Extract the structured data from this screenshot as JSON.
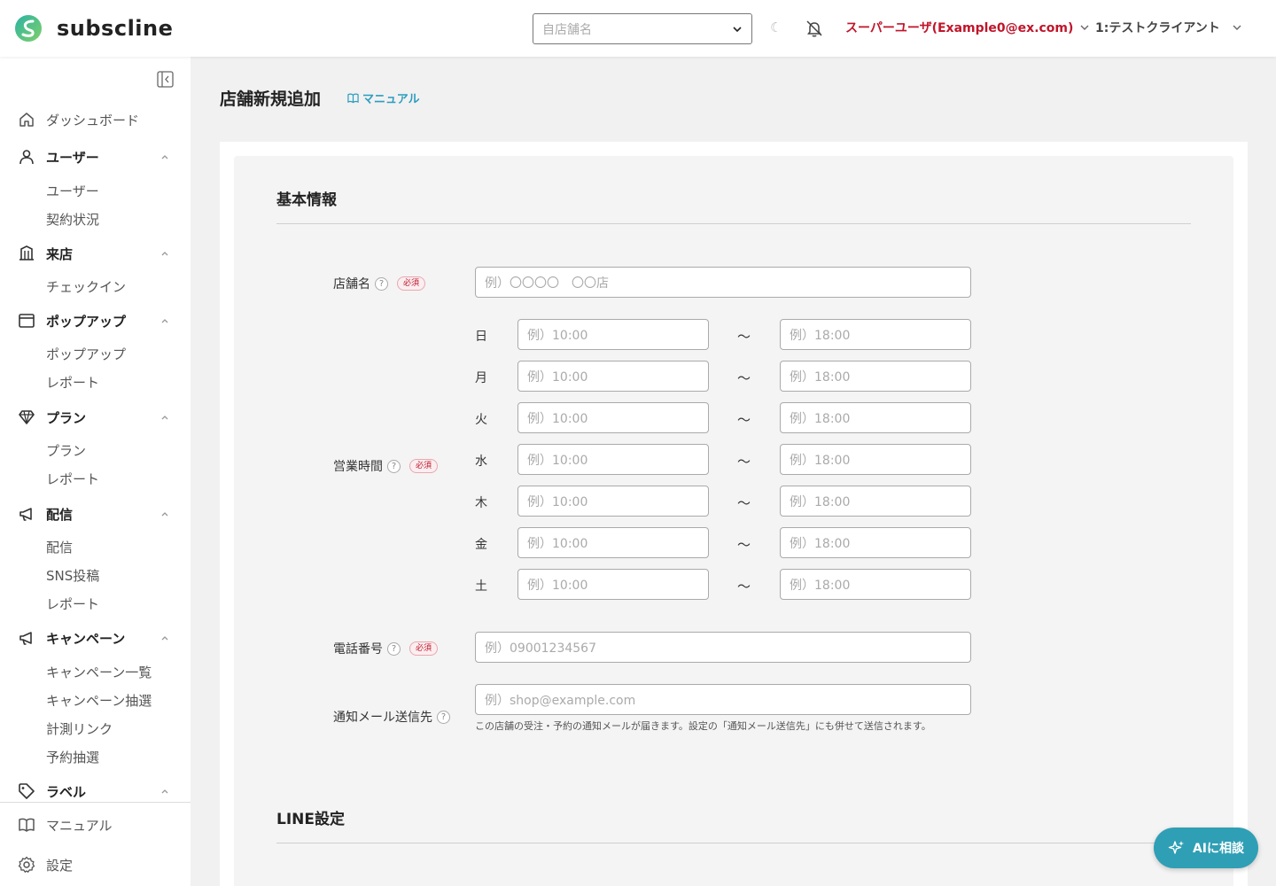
{
  "header": {
    "brand": "subscline",
    "store_select_placeholder": "自店舗名",
    "user_label": "スーパーユーザ(Example0@ex.com)",
    "client_label": "1:テストクライアント",
    "accent_color": "#c0152a"
  },
  "sidebar": {
    "items": [
      {
        "label": "ダッシュボード",
        "icon": "home-icon",
        "group": false
      },
      {
        "label": "ユーザー",
        "icon": "user-icon",
        "group": true,
        "children": [
          "ユーザー",
          "契約状況"
        ]
      },
      {
        "label": "来店",
        "icon": "building-icon",
        "group": true,
        "children": [
          "チェックイン"
        ]
      },
      {
        "label": "ポップアップ",
        "icon": "window-icon",
        "group": true,
        "children": [
          "ポップアップ",
          "レポート"
        ]
      },
      {
        "label": "プラン",
        "icon": "diamond-icon",
        "group": true,
        "children": [
          "プラン",
          "レポート"
        ]
      },
      {
        "label": "配信",
        "icon": "megaphone-icon",
        "group": true,
        "children": [
          "配信",
          "SNS投稿",
          "レポート"
        ]
      },
      {
        "label": "キャンペーン",
        "icon": "megaphone-icon",
        "group": true,
        "children": [
          "キャンペーン一覧",
          "キャンペーン抽選",
          "計測リンク",
          "予約抽選"
        ]
      },
      {
        "label": "ラベル",
        "icon": "tag-icon",
        "group": true,
        "children": []
      }
    ],
    "bottom": [
      {
        "label": "マニュアル",
        "icon": "book-icon"
      },
      {
        "label": "設定",
        "icon": "gear-icon"
      }
    ]
  },
  "main": {
    "title": "店舗新規追加",
    "manual_link": "マニュアル",
    "sections": {
      "basic": "基本情報",
      "line": "LINE設定"
    },
    "required_badge": "必須",
    "store_name": {
      "label": "店舗名",
      "placeholder": "例）〇〇〇〇　〇〇店"
    },
    "hours": {
      "label": "営業時間",
      "separator": "〜",
      "open_placeholder": "例）10:00",
      "close_placeholder": "例）18:00",
      "days": [
        "日",
        "月",
        "火",
        "水",
        "木",
        "金",
        "土"
      ]
    },
    "phone": {
      "label": "電話番号",
      "placeholder": "例）09001234567"
    },
    "notify_email": {
      "label": "通知メール送信先",
      "placeholder": "例）shop@example.com",
      "note": "この店舗の受注・予約の通知メールが届きます。設定の「通知メール送信先」にも併せて送信されます。"
    }
  },
  "ai_button": "AIに相談",
  "colors": {
    "teal": "#2f9fb5",
    "link": "#2b9dbf"
  }
}
